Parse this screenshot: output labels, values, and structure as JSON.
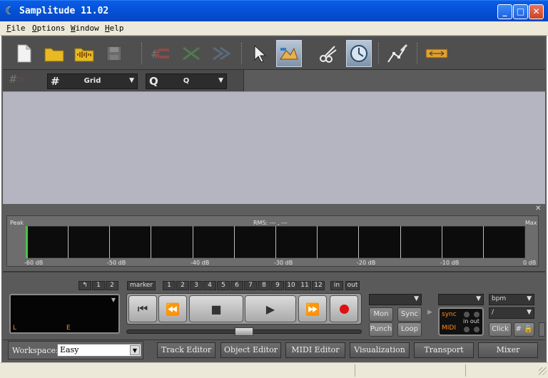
{
  "window": {
    "title": "Samplitude 11.02",
    "minimize_glyph": "_",
    "maximize_glyph": "□",
    "close_glyph": "✕"
  },
  "menu": [
    {
      "first": "F",
      "rest": "ile"
    },
    {
      "first": "O",
      "rest": "ptions"
    },
    {
      "first": "W",
      "rest": "indow"
    },
    {
      "first": "H",
      "rest": "elp"
    }
  ],
  "toolbar": {
    "icons": [
      "new-file-icon",
      "open-folder-icon",
      "open-audio-icon",
      "save-icon",
      "magnet-icon",
      "crossfade-icon",
      "merge-icon",
      "pointer-tool-icon",
      "volume-curve-tool-icon",
      "cut-tool-icon",
      "time-stretch-tool-icon",
      "draw-curve-tool-icon",
      "range-tool-icon"
    ]
  },
  "snap_row": {
    "snap_glyph": "#",
    "grid_prefix": "#",
    "grid_value": "Grid",
    "q_prefix": "Q",
    "q_value": "Q",
    "arrow": "▼"
  },
  "meter": {
    "close_glyph": "✕",
    "peak_label": "Peak",
    "rms_label": "RMS: --- , ---",
    "max_label": "Max",
    "scale": [
      "-60 dB",
      "-50 dB",
      "-40 dB",
      "-30 dB",
      "-20 dB",
      "-10 dB",
      "0 dB"
    ]
  },
  "transport": {
    "back_glyph": "↰",
    "marker_label": "marker",
    "sets": [
      "1",
      "2"
    ],
    "markers": [
      "1",
      "2",
      "3",
      "4",
      "5",
      "6",
      "7",
      "8",
      "9",
      "10",
      "11",
      "12"
    ],
    "in_label": "in",
    "out_label": "out",
    "display": {
      "left_marker": "L",
      "end_marker": "E",
      "arrow": "▼"
    },
    "buttons": {
      "rewind_start": "⏮",
      "rewind": "⏪",
      "stop": "■",
      "play": "▶",
      "forward": "⏩"
    },
    "mon": "Mon",
    "sync": "Sync",
    "punch": "Punch",
    "loop": "Loop",
    "sync_label": "sync",
    "midi_label": "MIDI",
    "in_out": "in out",
    "bpm": "bpm",
    "slash": "/",
    "click": "Click",
    "hash_lock": "# 🔒"
  },
  "workspace": {
    "label": "Workspace:",
    "value": "Easy",
    "tabs": [
      "Track Editor",
      "Object Editor",
      "MIDI Editor",
      "Visualization",
      "Transport",
      "Mixer"
    ]
  },
  "colors": {
    "record": "#e01010",
    "sync_orange": "#ff8a1a"
  }
}
